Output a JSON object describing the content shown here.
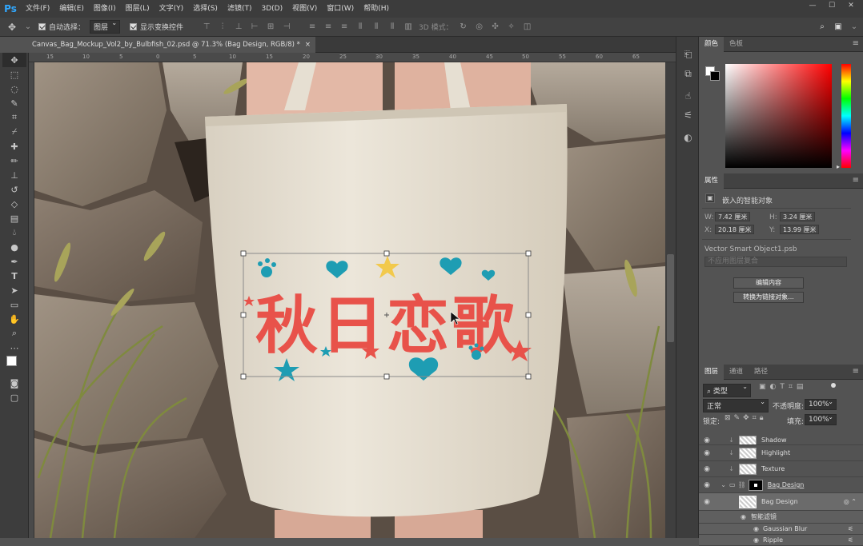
{
  "app": {
    "logo": "Ps",
    "menus": [
      "文件(F)",
      "编辑(E)",
      "图像(I)",
      "图层(L)",
      "文字(Y)",
      "选择(S)",
      "滤镜(T)",
      "3D(D)",
      "视图(V)",
      "窗口(W)",
      "帮助(H)"
    ]
  },
  "window_controls": [
    "—",
    "☐",
    "✕"
  ],
  "options": {
    "auto_select_label": "自动选择：",
    "auto_select_value": "图层",
    "show_transform_label": "显示变换控件",
    "mode_3d_label": "3D 模式："
  },
  "document": {
    "tab_title": "Canvas_Bag_Mockup_Vol2_by_Bulbfish_02.psd @ 71.3% (Bag Design, RGB/8) *",
    "close": "×"
  },
  "ruler": {
    "ticks": [
      "15",
      "10",
      "5",
      "0",
      "5",
      "10",
      "15",
      "20",
      "25",
      "30",
      "35",
      "40",
      "45",
      "50",
      "55",
      "60",
      "65"
    ]
  },
  "artwork": {
    "text": "秋日恋歌"
  },
  "color_panel": {
    "tabs": [
      "颜色",
      "色板"
    ]
  },
  "properties": {
    "tab": "属性",
    "type_label": "嵌入的智能对象",
    "w_label": "W:",
    "w_value": "7.42 厘米",
    "h_label": "H:",
    "h_value": "3.24 厘米",
    "x_label": "X:",
    "x_value": "20.18 厘米",
    "y_label": "Y:",
    "y_value": "13.99 厘米",
    "source_file": "Vector Smart Object1.psb",
    "comp_placeholder": "不应用图层复合",
    "edit_button": "编辑内容",
    "convert_button": "转换为链接对象..."
  },
  "layers_panel": {
    "tabs": [
      "图层",
      "通道",
      "路径"
    ],
    "filter_kind": "类型",
    "blend_mode": "正常",
    "opacity_label": "不透明度:",
    "opacity_value": "100%",
    "lock_label": "锁定:",
    "fill_label": "填充:",
    "fill_value": "100%",
    "layers": [
      {
        "name": "Shadow"
      },
      {
        "name": "Highlight"
      },
      {
        "name": "Texture"
      },
      {
        "name": "Bag Design"
      },
      {
        "name": "Bag Design"
      },
      {
        "name": "智能滤镜"
      },
      {
        "name": "Gaussian Blur"
      },
      {
        "name": "Ripple"
      }
    ]
  },
  "colors": {
    "accent": "#31a8ff",
    "artwork_red": "#e8524a",
    "artwork_teal": "#1e9db3",
    "artwork_yellow": "#f2c94c",
    "bag": "#e9e2d4"
  }
}
